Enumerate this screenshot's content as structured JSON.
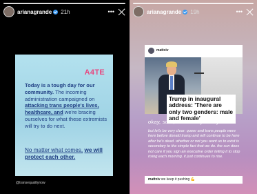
{
  "left_story": {
    "username": "arianagrande",
    "time": "21h",
    "logo": "A4TE",
    "post_bold_1": "Today is a tough day for our community.",
    "post_plain_1": " The incoming administration campaigned on ",
    "post_bold_2": "attacking trans people's lives, healthcare, and",
    "post_plain_2": " we're bracing ourselves for what these extremists will try to do next.",
    "cta_1": "No matter what comes,",
    "cta_2": "we will protect each other.",
    "handle": "@transequalitynow",
    "icons": [
      "verified-icon",
      "more-icon",
      "close-icon"
    ]
  },
  "right_story": {
    "username": "arianagrande",
    "time": "19h",
    "shared_user": "mattxiv",
    "headline": "Trump in inaugural address: 'There are only two genders: male and female'",
    "okay_line": "okay, sure, whatever you say.",
    "body": "but let's be very clear: queer and trans people were here before donald trump and will continue to be here after he's dead. whether or not you want us to exist is secondary to the simple fact that we do. the sun does not care if you sign an executive order telling it to stop rising each morning. it just continues to rise.",
    "footer_user": "mattxiv",
    "footer_text": "we keep it pushing 💪"
  }
}
